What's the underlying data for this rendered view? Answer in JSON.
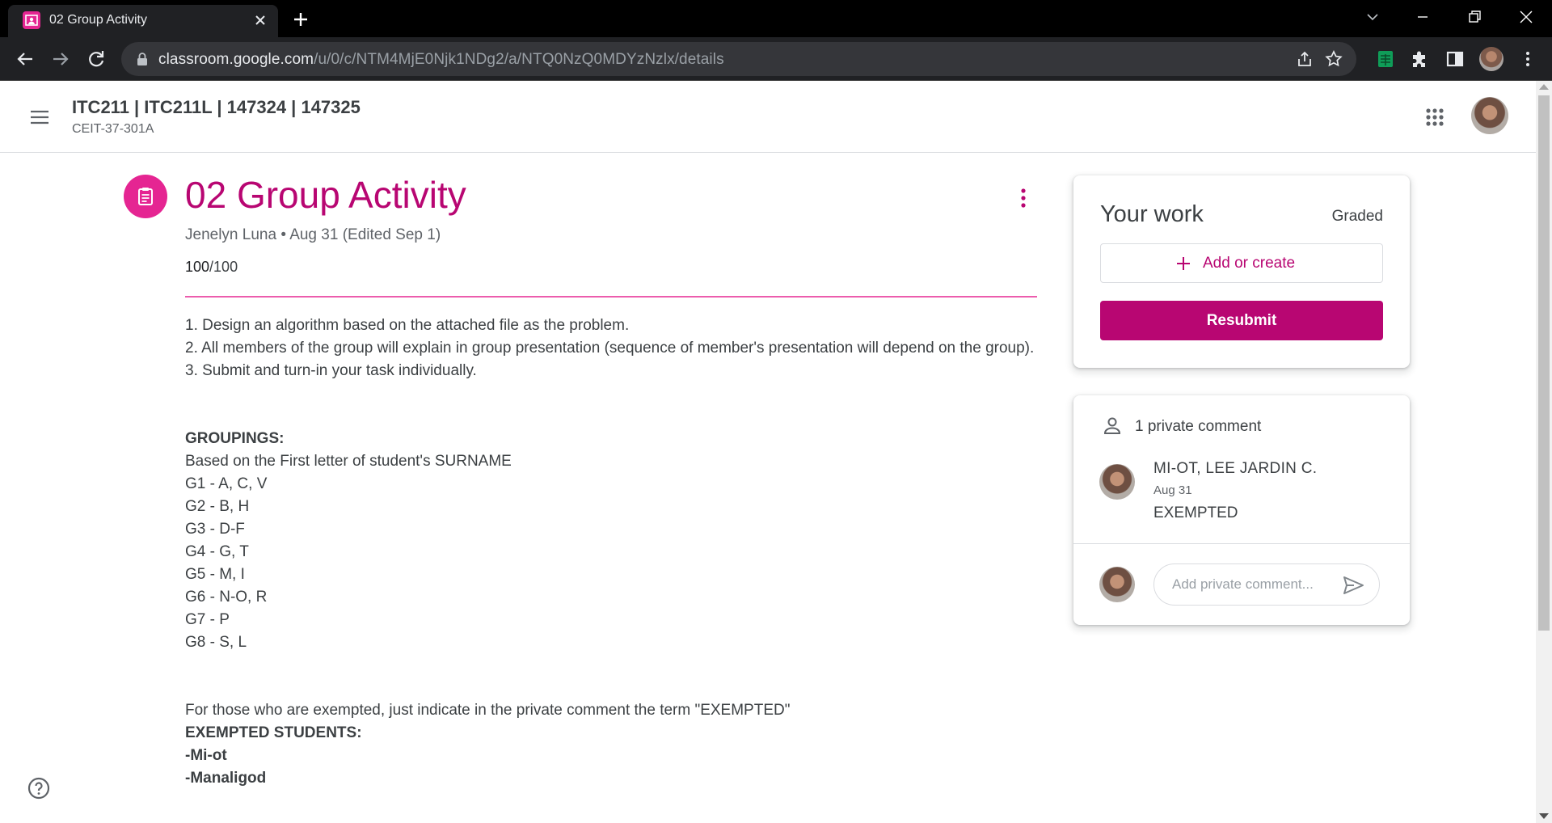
{
  "browser": {
    "tab_title": "02 Group Activity",
    "url_host": "classroom.google.com",
    "url_path": "/u/0/c/NTM4MjE0Njk1NDg2/a/NTQ0NzQ0MDYzNzlx/details",
    "icons": [
      "classroom-favicon",
      "close-icon",
      "plus-icon",
      "chevron-down-icon",
      "minimize-icon",
      "restore-icon",
      "window-close-icon",
      "back-arrow-icon",
      "forward-arrow-icon",
      "reload-icon",
      "lock-icon",
      "share-icon",
      "star-icon",
      "sheets-extension-icon",
      "puzzle-icon",
      "side-panel-icon",
      "kebab-menu-icon"
    ]
  },
  "header": {
    "course_title": "ITC211 | ITC211L | 147324 | 147325",
    "course_section": "CEIT-37-301A"
  },
  "assignment": {
    "title": "02 Group Activity",
    "meta": "Jenelyn Luna • Aug 31 (Edited Sep 1)",
    "points_earned": "100",
    "points_total": "/100",
    "instructions": {
      "step1": "1. Design an algorithm based on the attached file as the problem.",
      "step2": "2. All members of the group will explain in group presentation (sequence of member's presentation will depend on the group).",
      "step3": "3. Submit and turn-in your task individually.",
      "groupings_heading": "GROUPINGS:",
      "groupings_basis": "Based on the First letter of student's SURNAME",
      "groups": [
        "G1 - A, C, V",
        "G2 - B, H",
        "G3 - D-F",
        "G4 - G, T",
        "G5 - M, I",
        "G6 - N-O, R",
        "G7 - P",
        "G8 - S, L"
      ],
      "exempt_note": "For those who are exempted, just indicate in the private comment the term \"EXEMPTED\"",
      "exempted_heading": "EXEMPTED STUDENTS:",
      "exempted": [
        "-Mi-ot",
        "-Manaligod"
      ]
    }
  },
  "your_work": {
    "title": "Your work",
    "status": "Graded",
    "add_label": "Add or create",
    "resubmit_label": "Resubmit"
  },
  "comments": {
    "count_label": "1 private comment",
    "items": [
      {
        "author": "MI-OT, LEE JARDIN C.",
        "date": "Aug 31",
        "text": "EXEMPTED"
      }
    ],
    "input_placeholder": "Add private comment..."
  },
  "colors": {
    "accent": "#b80672",
    "accent_icon": "#e52592",
    "chrome_dark": "#202124"
  }
}
